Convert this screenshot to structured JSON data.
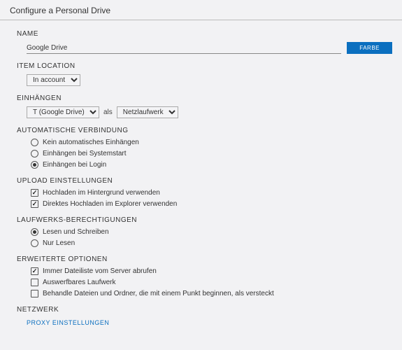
{
  "header": {
    "title": "Configure a Personal Drive"
  },
  "name": {
    "label": "NAME",
    "value": "Google Drive",
    "color_button": "FARBE"
  },
  "item_location": {
    "label": "ITEM LOCATION",
    "selected": "In account"
  },
  "mount": {
    "label": "EINHÄNGEN",
    "drive_selected": "T (Google Drive)",
    "als": "als",
    "type_selected": "Netzlaufwerk"
  },
  "auto_connect": {
    "label": "AUTOMATISCHE VERBINDUNG",
    "options": [
      {
        "label": "Kein automatisches Einhängen",
        "checked": false
      },
      {
        "label": "Einhängen bei Systemstart",
        "checked": false
      },
      {
        "label": "Einhängen bei Login",
        "checked": true
      }
    ]
  },
  "upload": {
    "label": "UPLOAD EINSTELLUNGEN",
    "options": [
      {
        "label": "Hochladen im Hintergrund verwenden",
        "checked": true
      },
      {
        "label": "Direktes Hochladen im Explorer verwenden",
        "checked": true
      }
    ]
  },
  "permissions": {
    "label": "LAUFWERKS-BERECHTIGUNGEN",
    "options": [
      {
        "label": "Lesen und Schreiben",
        "checked": true
      },
      {
        "label": "Nur Lesen",
        "checked": false
      }
    ]
  },
  "advanced": {
    "label": "ERWEITERTE OPTIONEN",
    "options": [
      {
        "label": "Immer Dateiliste vom Server abrufen",
        "checked": true
      },
      {
        "label": "Auswerfbares Laufwerk",
        "checked": false
      },
      {
        "label": "Behandle Dateien und Ordner, die mit einem Punkt beginnen, als versteckt",
        "checked": false
      }
    ]
  },
  "network": {
    "label": "NETZWERK",
    "proxy_link": "PROXY EINSTELLUNGEN"
  }
}
